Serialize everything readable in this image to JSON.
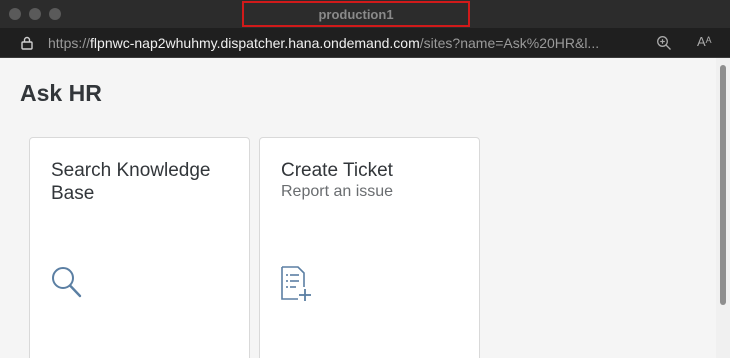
{
  "window": {
    "title": "production1"
  },
  "address_bar": {
    "url_protocol": "https://",
    "url_host": "flpnwc-nap2whuhmy.dispatcher.hana.ondemand.com",
    "url_rest": "/sites?name=Ask%20HR&l..."
  },
  "page": {
    "title": "Ask HR",
    "tiles": [
      {
        "title": "Search Knowledge Base",
        "subtitle": "",
        "icon": "search-icon"
      },
      {
        "title": "Create Ticket",
        "subtitle": "Report an issue",
        "icon": "add-document-icon"
      }
    ]
  },
  "colors": {
    "accent_icon": "#5b7fa3",
    "title_highlight": "#d11a1a"
  }
}
